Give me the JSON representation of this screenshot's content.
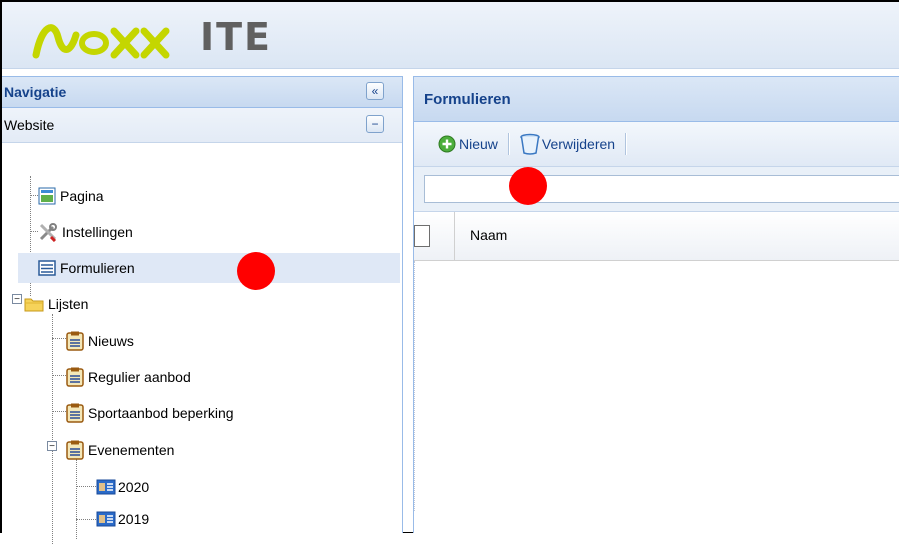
{
  "app": {
    "logo_text": "ITE"
  },
  "navigation": {
    "title": "Navigatie",
    "collapse_glyph": "«",
    "section": "Website",
    "section_toggle_glyph": "−",
    "items": [
      {
        "label": "Pagina",
        "icon": "page-icon"
      },
      {
        "label": "Instellingen",
        "icon": "tools-icon"
      },
      {
        "label": "Formulieren",
        "icon": "form-icon"
      },
      {
        "label": "Lijsten",
        "icon": "folder-icon"
      },
      {
        "label": "Nieuws",
        "icon": "list-icon"
      },
      {
        "label": "Regulier aanbod",
        "icon": "list-icon"
      },
      {
        "label": "Sportaanbod beperking",
        "icon": "list-icon"
      },
      {
        "label": "Evenementen",
        "icon": "list-icon"
      },
      {
        "label": "2020",
        "icon": "card-icon"
      },
      {
        "label": "2019",
        "icon": "card-icon"
      }
    ]
  },
  "main": {
    "title": "Formulieren",
    "toolbar": {
      "new_label": "Nieuw",
      "delete_label": "Verwijderen"
    },
    "search": {
      "value": "",
      "placeholder": ""
    },
    "grid": {
      "columns": [
        "Naam"
      ],
      "rows": []
    }
  },
  "colors": {
    "accent": "#15428b",
    "selected": "#dfe8f6",
    "marker": "#ff0000",
    "logo_green": "#c4d600"
  }
}
